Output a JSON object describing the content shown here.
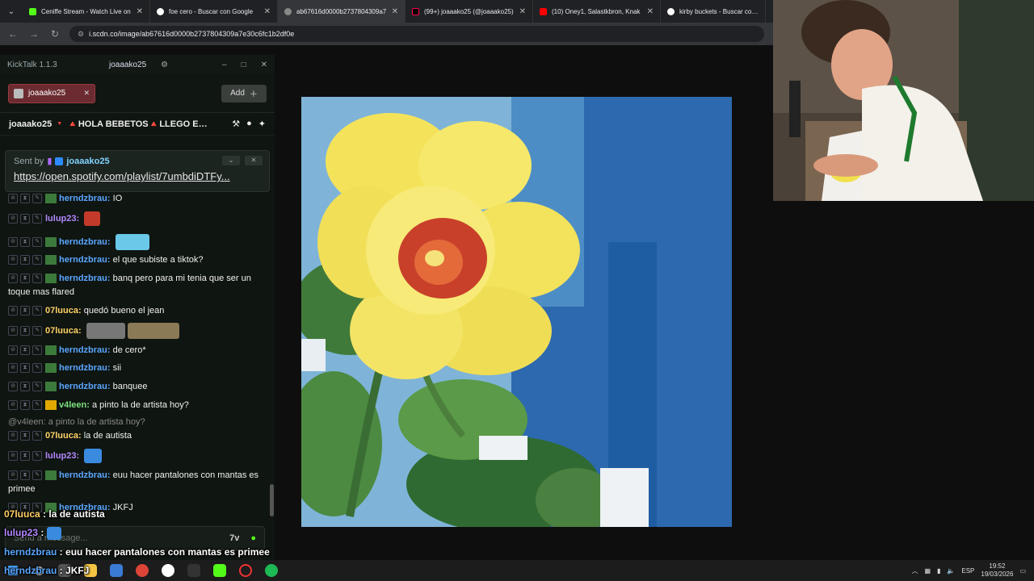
{
  "browser": {
    "tabs": [
      {
        "title": "Ceniffe Stream - Watch Live on",
        "color": "#53fc18"
      },
      {
        "title": "foe cero - Buscar con Google",
        "color": "#4285f4"
      },
      {
        "title": "ab67616d0000b2737804309a7",
        "color": "#888888"
      },
      {
        "title": "(99+) joaaako25 (@joaaako25)",
        "color": "#ff0050"
      },
      {
        "title": "(10) Oney1, Salastkbron, Knak",
        "color": "#ff0000"
      },
      {
        "title": "kirby buckets - Buscar con Goo",
        "color": "#4285f4"
      }
    ],
    "url": "i.scdn.co/image/ab67616d0000b2737804309a7e30c6fc1b2df0e"
  },
  "kicktalk": {
    "version": "KickTalk 1.1.3",
    "user": "joaaako25",
    "channel_tab": "joaaako25",
    "add_label": "Add",
    "header_name": "joaaako25",
    "header_title": "🔺HOLA BEBETOS🔺LLEGO EL M...",
    "pinned": {
      "sent_by": "Sent by",
      "user": "joaaako25",
      "link": "https://open.spotify.com/playlist/7umbdiDTFy..."
    },
    "input_placeholder": "Send a message...",
    "messages": [
      {
        "user": "herndzbrau",
        "text": "IO",
        "color": "#5aa6ff"
      },
      {
        "user": "lulup23",
        "text": "",
        "color": "#b388ff"
      },
      {
        "user": "herndzbrau",
        "text": "",
        "color": "#5aa6ff"
      },
      {
        "user": "herndzbrau",
        "text": "el que subiste a tiktok?",
        "color": "#5aa6ff"
      },
      {
        "user": "herndzbrau",
        "text": "banq pero para mi tenia que ser un toque mas flared",
        "color": "#5aa6ff"
      },
      {
        "user": "07luuca",
        "text": "quedó bueno el jean",
        "color": "#ffd166"
      },
      {
        "user": "07luuca",
        "text": "",
        "color": "#ffd166"
      },
      {
        "user": "herndzbrau",
        "text": "de cero*",
        "color": "#5aa6ff"
      },
      {
        "user": "herndzbrau",
        "text": "sii",
        "color": "#5aa6ff"
      },
      {
        "user": "herndzbrau",
        "text": "banquee",
        "color": "#5aa6ff"
      },
      {
        "user": "v4leen",
        "text": "a pinto la de artista hoy?",
        "color": "#7ee07e"
      },
      {
        "user": "07luuca",
        "text": "la de autista",
        "color": "#ffd166"
      },
      {
        "user": "lulup23",
        "text": "",
        "color": "#b388ff"
      },
      {
        "user": "herndzbrau",
        "text": "euu hacer pantalones con mantas es primee",
        "color": "#5aa6ff"
      },
      {
        "user": "herndzbrau",
        "text": "JKFJ",
        "color": "#5aa6ff"
      }
    ],
    "reply": {
      "user": "@v4leen",
      "text": "a pinto la de artista hoy?"
    }
  },
  "overlay": [
    {
      "user": "07luuca",
      "text": "la de autista",
      "color": "#ffd166"
    },
    {
      "user": "lulup23",
      "text": "",
      "color": "#b388ff"
    },
    {
      "user": "herndzbrau",
      "text": "euu hacer pantalones con mantas es primee",
      "color": "#5aa6ff"
    },
    {
      "user": "herndzbrau",
      "text": "JKFJ",
      "color": "#5aa6ff"
    }
  ],
  "taskbar": {
    "lang": "ESP",
    "time": "19:52",
    "date": "19/03/2026"
  }
}
